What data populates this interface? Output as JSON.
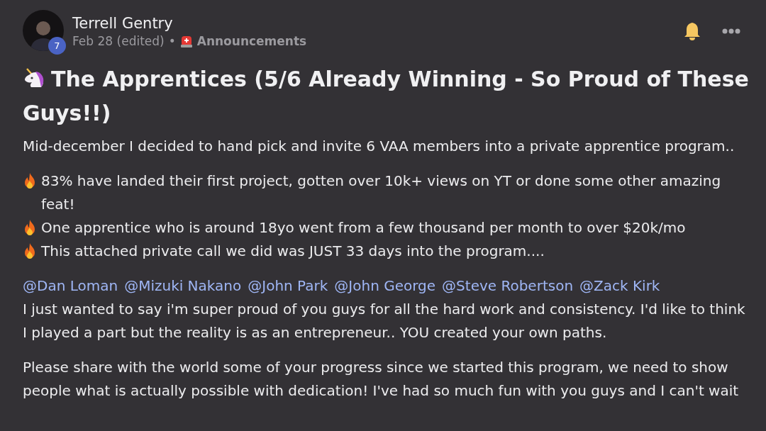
{
  "post": {
    "author": {
      "name": "Terrell Gentry",
      "badge": "7"
    },
    "meta": {
      "date": "Feb 28 (edited)",
      "separator": "•",
      "category": "Announcements"
    },
    "title": "The Apprentices (5/6 Already Winning - So Proud of These Guys!!)",
    "blocks": [
      {
        "kind": "paragraph",
        "lines": [
          "Mid-december I decided to hand pick and invite 6 VAA members into a private apprentice program.."
        ]
      },
      {
        "kind": "bullets",
        "lines": [
          "83% have landed their first project, gotten over 10k+ views on YT or done some other amazing feat!",
          "One apprentice who is around 18yo went from a few thousand per month to over $20k/mo",
          "This attached private call we did was JUST 33 days into the program...."
        ]
      },
      {
        "kind": "mentions",
        "mentions": [
          "@Dan Loman",
          "@Mizuki Nakano",
          "@John Park",
          "@John George",
          "@Steve Robertson",
          "@Zack Kirk"
        ],
        "lines": [
          "I just wanted to say i'm super proud of you guys for all the hard work and consistency. I'd like to think I played a part but the reality is as an entrepreneur.. YOU created your own paths."
        ]
      },
      {
        "kind": "paragraph",
        "lines": [
          "Please share with the world some of your progress since we started this program, we need to show people what is actually possible with dedication! I've had so much fun with you guys and I can't wait"
        ]
      }
    ]
  }
}
